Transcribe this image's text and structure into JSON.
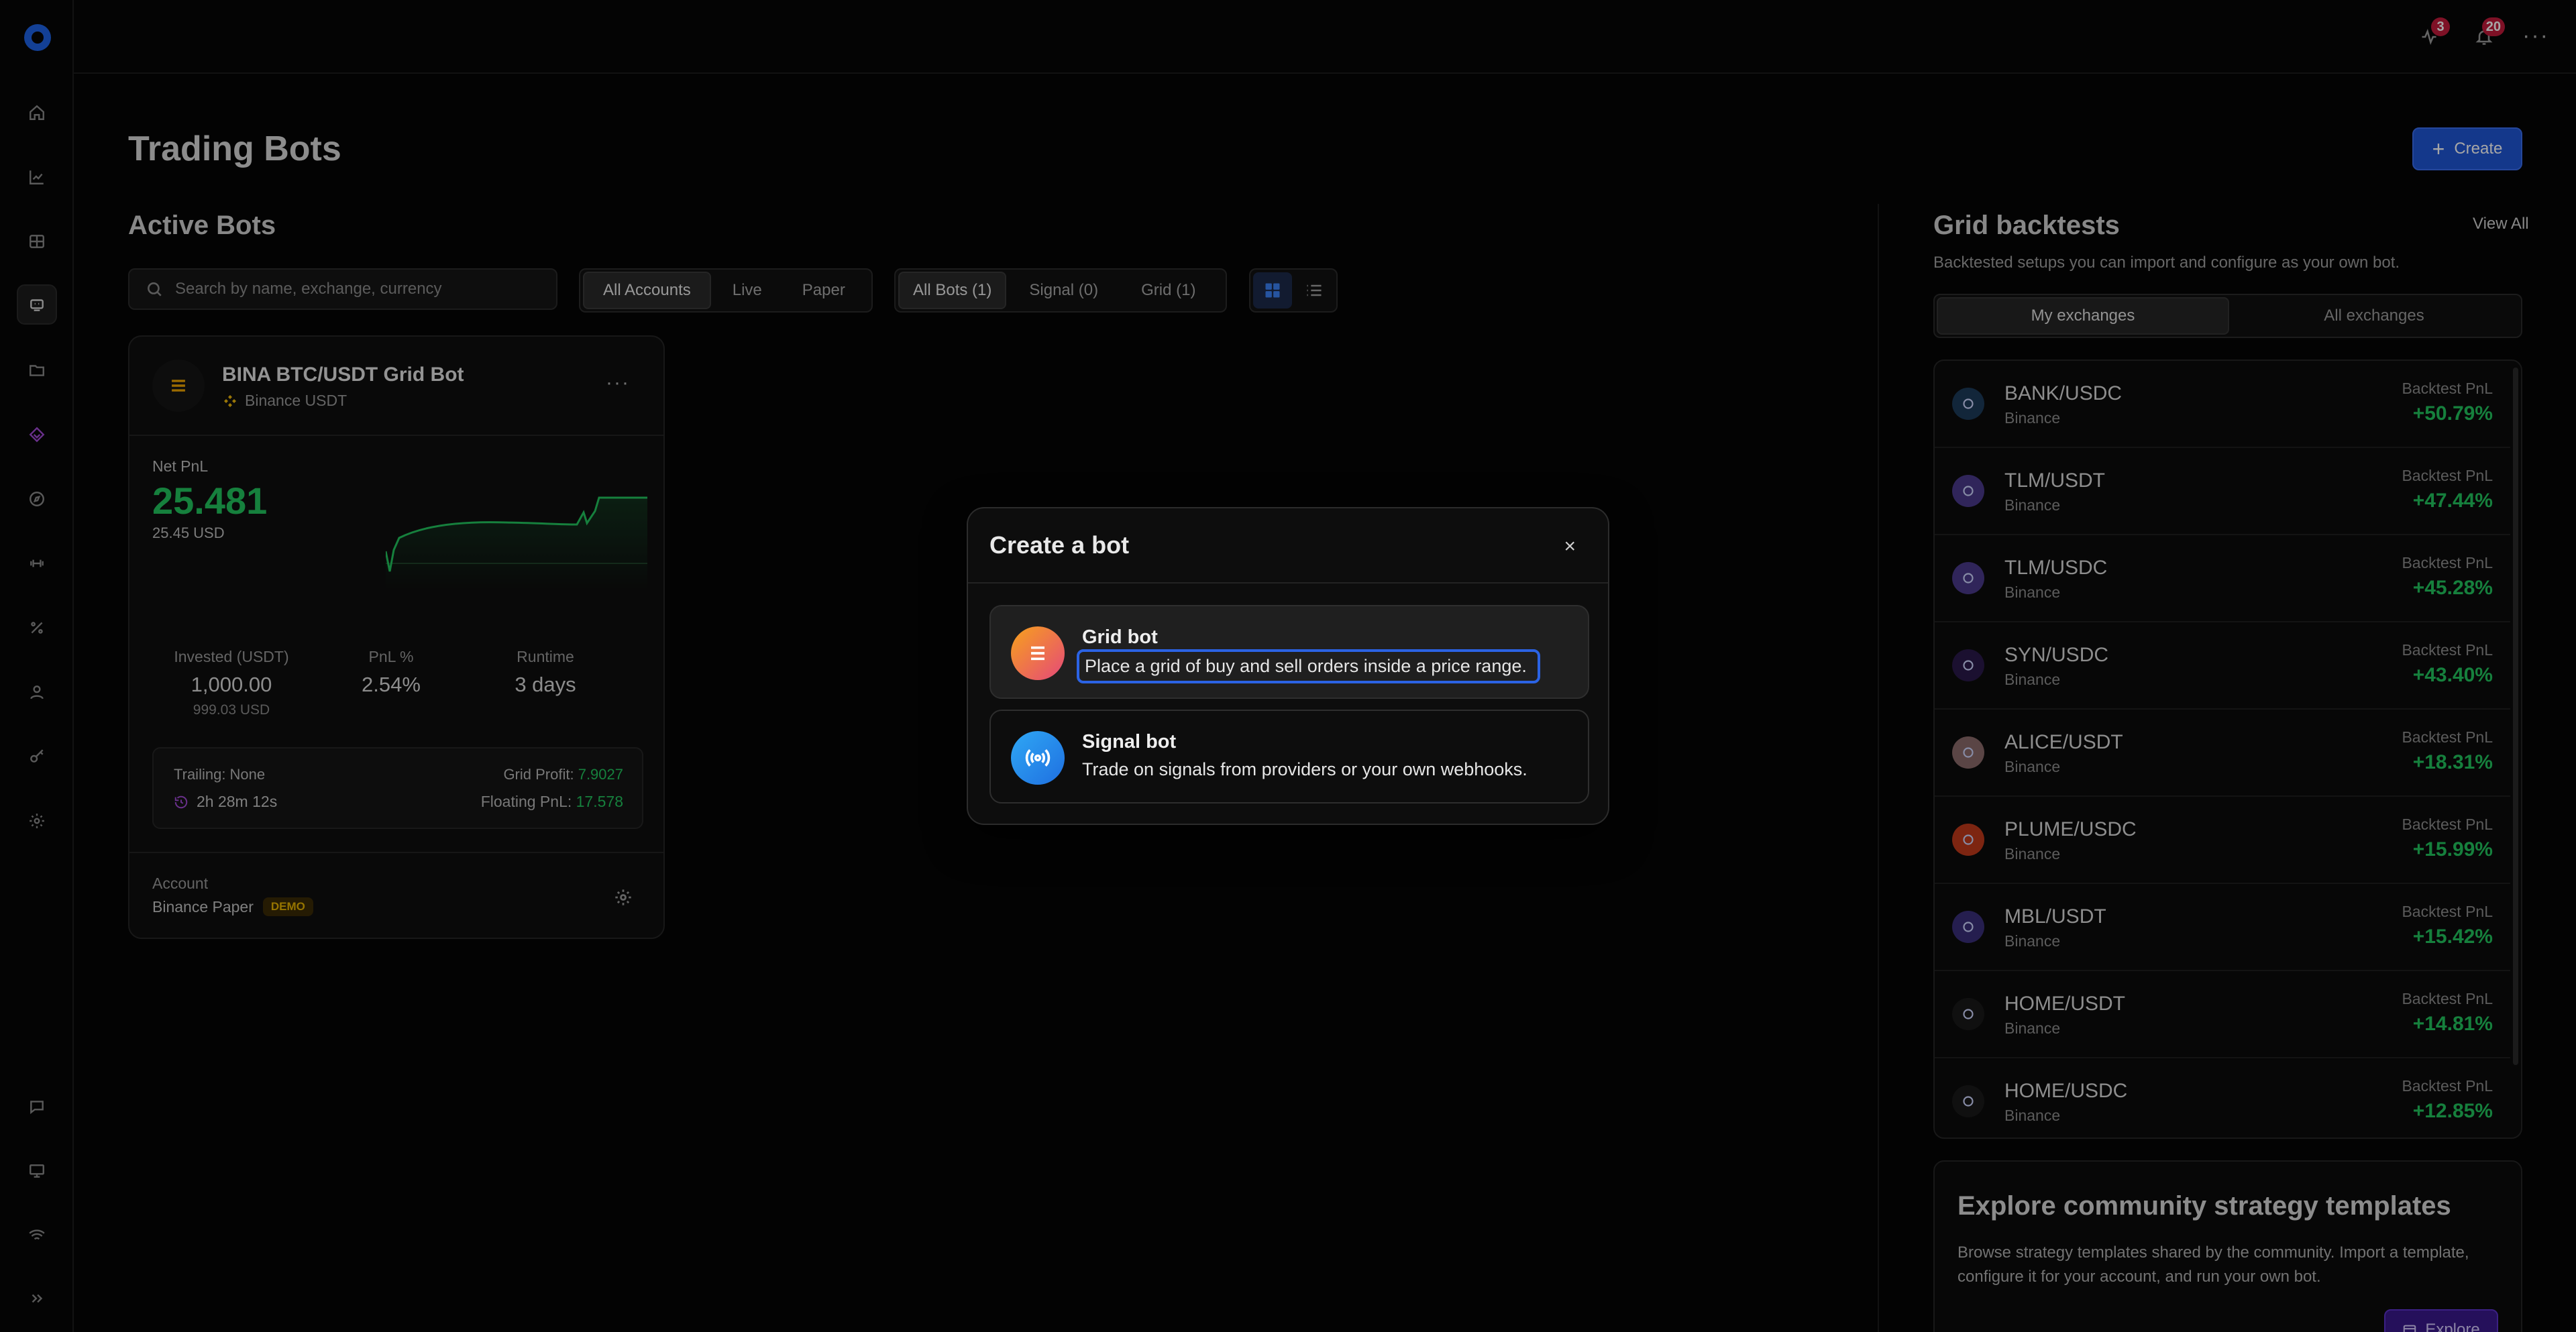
{
  "topbar": {
    "activity_badge": "3",
    "notifications_badge": "20",
    "more": "···"
  },
  "header": {
    "title": "Trading Bots",
    "create_label": "Create"
  },
  "active": {
    "title": "Active Bots",
    "search_placeholder": "Search by name, exchange, currency",
    "account_filters": [
      "All Accounts",
      "Live",
      "Paper"
    ],
    "bot_filters": [
      "All Bots (1)",
      "Signal (0)",
      "Grid (1)"
    ]
  },
  "bot": {
    "name": "BINA BTC/USDT Grid Bot",
    "exchange": "Binance USDT",
    "net_pnl_label": "Net PnL",
    "net_pnl": "25.481",
    "net_pnl_usd": "25.45 USD",
    "invested_label": "Invested (USDT)",
    "invested": "1,000.00",
    "invested_usd": "999.03 USD",
    "pnl_pct_label": "PnL %",
    "pnl_pct": "2.54%",
    "runtime_label": "Runtime",
    "runtime": "3 days",
    "trailing": "Trailing: None",
    "timer": "2h 28m 12s",
    "grid_profit_label": "Grid Profit:",
    "grid_profit": "7.9027",
    "floating_label": "Floating PnL:",
    "floating": "17.578",
    "account_label": "Account",
    "account": "Binance Paper",
    "demo": "DEMO"
  },
  "backtests": {
    "title": "Grid backtests",
    "view_all": "View All",
    "subtitle": "Backtested setups you can import and configure as your own bot.",
    "tabs": [
      "My exchanges",
      "All exchanges"
    ],
    "pnl_label": "Backtest PnL",
    "rows": [
      {
        "pair": "BANK/USDC",
        "exchange": "Binance",
        "pnl": "+50.79%",
        "color": "#1d3b5a"
      },
      {
        "pair": "TLM/USDT",
        "exchange": "Binance",
        "pnl": "+47.44%",
        "color": "#4a3a8a"
      },
      {
        "pair": "TLM/USDC",
        "exchange": "Binance",
        "pnl": "+45.28%",
        "color": "#4a3a8a"
      },
      {
        "pair": "SYN/USDC",
        "exchange": "Binance",
        "pnl": "+43.40%",
        "color": "#2a1a4a"
      },
      {
        "pair": "ALICE/USDT",
        "exchange": "Binance",
        "pnl": "+18.31%",
        "color": "#8a6a6a"
      },
      {
        "pair": "PLUME/USDC",
        "exchange": "Binance",
        "pnl": "+15.99%",
        "color": "#c0391b"
      },
      {
        "pair": "MBL/USDT",
        "exchange": "Binance",
        "pnl": "+15.42%",
        "color": "#3a2f7a"
      },
      {
        "pair": "HOME/USDT",
        "exchange": "Binance",
        "pnl": "+14.81%",
        "color": "#1a1a1a"
      },
      {
        "pair": "HOME/USDC",
        "exchange": "Binance",
        "pnl": "+12.85%",
        "color": "#1a1a1a"
      }
    ]
  },
  "community": {
    "title": "Explore community strategy templates",
    "text": "Browse strategy templates shared by the community. Import a template, configure it for your account, and run your own bot.",
    "explore": "Explore"
  },
  "modal": {
    "title": "Create a bot",
    "close": "×",
    "options": [
      {
        "name": "Grid bot",
        "desc": "Place a grid of buy and sell orders inside a price range."
      },
      {
        "name": "Signal bot",
        "desc": "Trade on signals from providers or your own webhooks."
      }
    ]
  },
  "colors": {
    "accent": "#2056d6",
    "positive": "#22c55e",
    "badge": "#c21b3b"
  }
}
